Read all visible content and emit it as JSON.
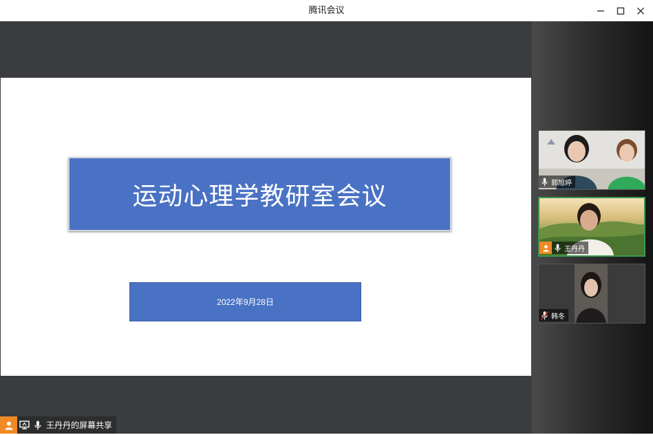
{
  "window": {
    "title": "腾讯会议"
  },
  "slide": {
    "title": "运动心理学教研室会议",
    "date": "2022年9月28日",
    "colors": {
      "box": "#4a72c4",
      "background": "#ffffff"
    }
  },
  "share_status": {
    "label": "王丹丹的屏幕共享"
  },
  "participants": [
    {
      "name": "郭旭婷",
      "mic": "on",
      "host": false
    },
    {
      "name": "王丹丹",
      "mic": "on",
      "host": true,
      "active": true
    },
    {
      "name": "韩冬",
      "mic": "muted",
      "host": false
    }
  ],
  "colors": {
    "host_badge": "#f08a24",
    "active_border": "#3c9a4e",
    "share_bg": "#3a3c3f"
  }
}
